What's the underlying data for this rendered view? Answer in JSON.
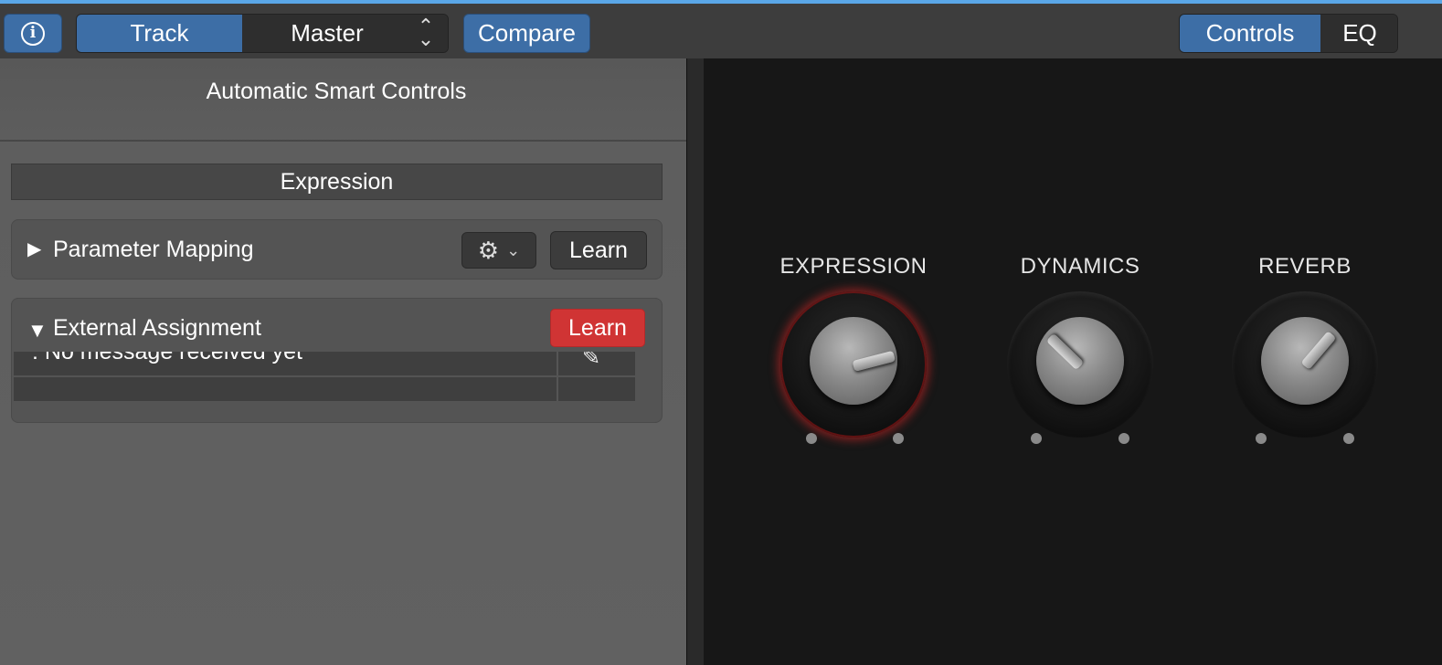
{
  "toolbar": {
    "info_glyph": "i",
    "track_label": "Track",
    "master_label": "Master",
    "stepper_glyph": "...",
    "compare_label": "Compare",
    "controls_label": "Controls",
    "eq_label": "EQ"
  },
  "inspector": {
    "title": "Automatic Smart Controls",
    "section_header": "Expression",
    "parameter_mapping": {
      "label": "Parameter Mapping",
      "expanded": false,
      "learn_label": "Learn"
    },
    "external_assignment": {
      "label": "External Assignment",
      "expanded": true,
      "learn_label": "Learn",
      "learn_active": true,
      "rows": [
        {
          "message": ": No message received yet"
        },
        {
          "message": ""
        }
      ]
    }
  },
  "knobs": [
    {
      "label": "EXPRESSION",
      "active": true,
      "value": 0.78
    },
    {
      "label": "DYNAMICS",
      "active": false,
      "value": 0.33
    },
    {
      "label": "REVERB",
      "active": false,
      "value": 0.65
    }
  ],
  "colors": {
    "accent_blue": "#3d6ea6",
    "learn_active_red": "#d03434",
    "knob_active_glow": "#dc2828"
  }
}
